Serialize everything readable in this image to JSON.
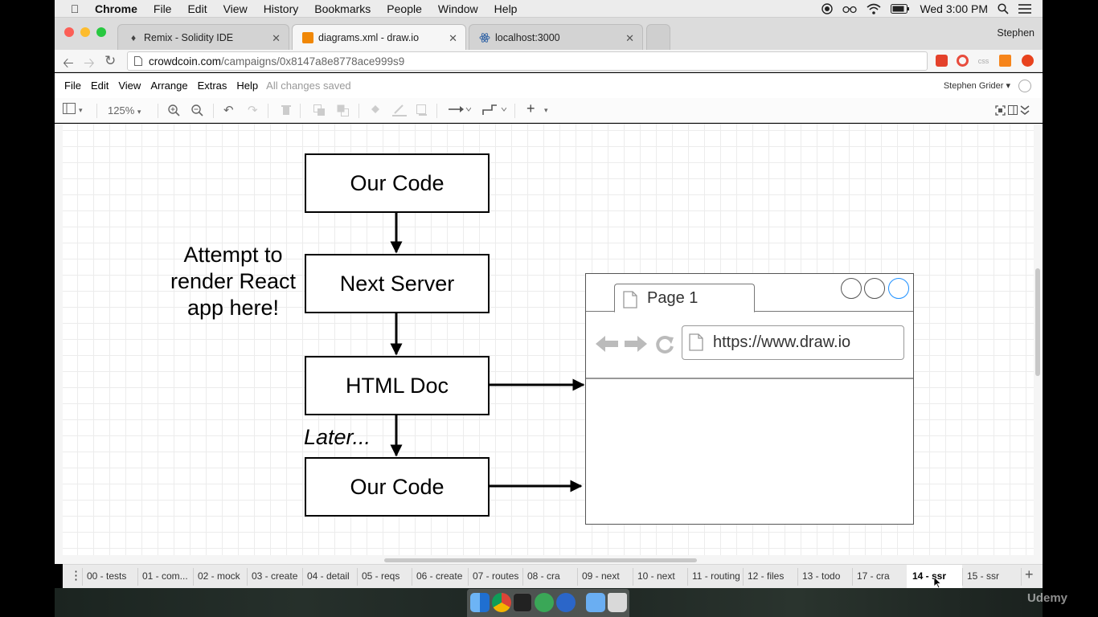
{
  "menubar": {
    "app": "Chrome",
    "items": [
      "File",
      "Edit",
      "View",
      "History",
      "Bookmarks",
      "People",
      "Window",
      "Help"
    ],
    "clock": "Wed 3:00 PM"
  },
  "browser": {
    "tabs": [
      {
        "label": "Remix - Solidity IDE",
        "active": false
      },
      {
        "label": "diagrams.xml - draw.io",
        "active": true
      },
      {
        "label": "localhost:3000",
        "active": false
      }
    ],
    "profile": "Stephen",
    "url_host": "crowdcoin.com",
    "url_path": "/campaigns/0x8147a8e8778ace999s9"
  },
  "drawio": {
    "menu": [
      "File",
      "Edit",
      "View",
      "Arrange",
      "Extras",
      "Help"
    ],
    "save_status": "All changes saved",
    "user": "Stephen Grider",
    "zoom": "125%"
  },
  "diagram": {
    "box1": "Our Code",
    "box2": "Next Server",
    "box3": "HTML Doc",
    "box4": "Our Code",
    "note_line1": "Attempt to",
    "note_line2": "render React",
    "note_line3": "app here!",
    "later": "Later...",
    "mock_tab": "Page 1",
    "mock_url": "https://www.draw.io"
  },
  "page_tabs": [
    "00 - tests",
    "01 - com...",
    "02 - mock",
    "03 - create",
    "04 - detail",
    "05 - reqs",
    "06 - create",
    "07 - routes",
    "08 - cra",
    "09 - next",
    "10 - next",
    "11 - routing",
    "12 - files",
    "13 - todo",
    "17 - cra",
    "14 - ssr",
    "15 - ssr"
  ],
  "selected_page_tab": "14 - ssr",
  "watermark": "Udemy"
}
